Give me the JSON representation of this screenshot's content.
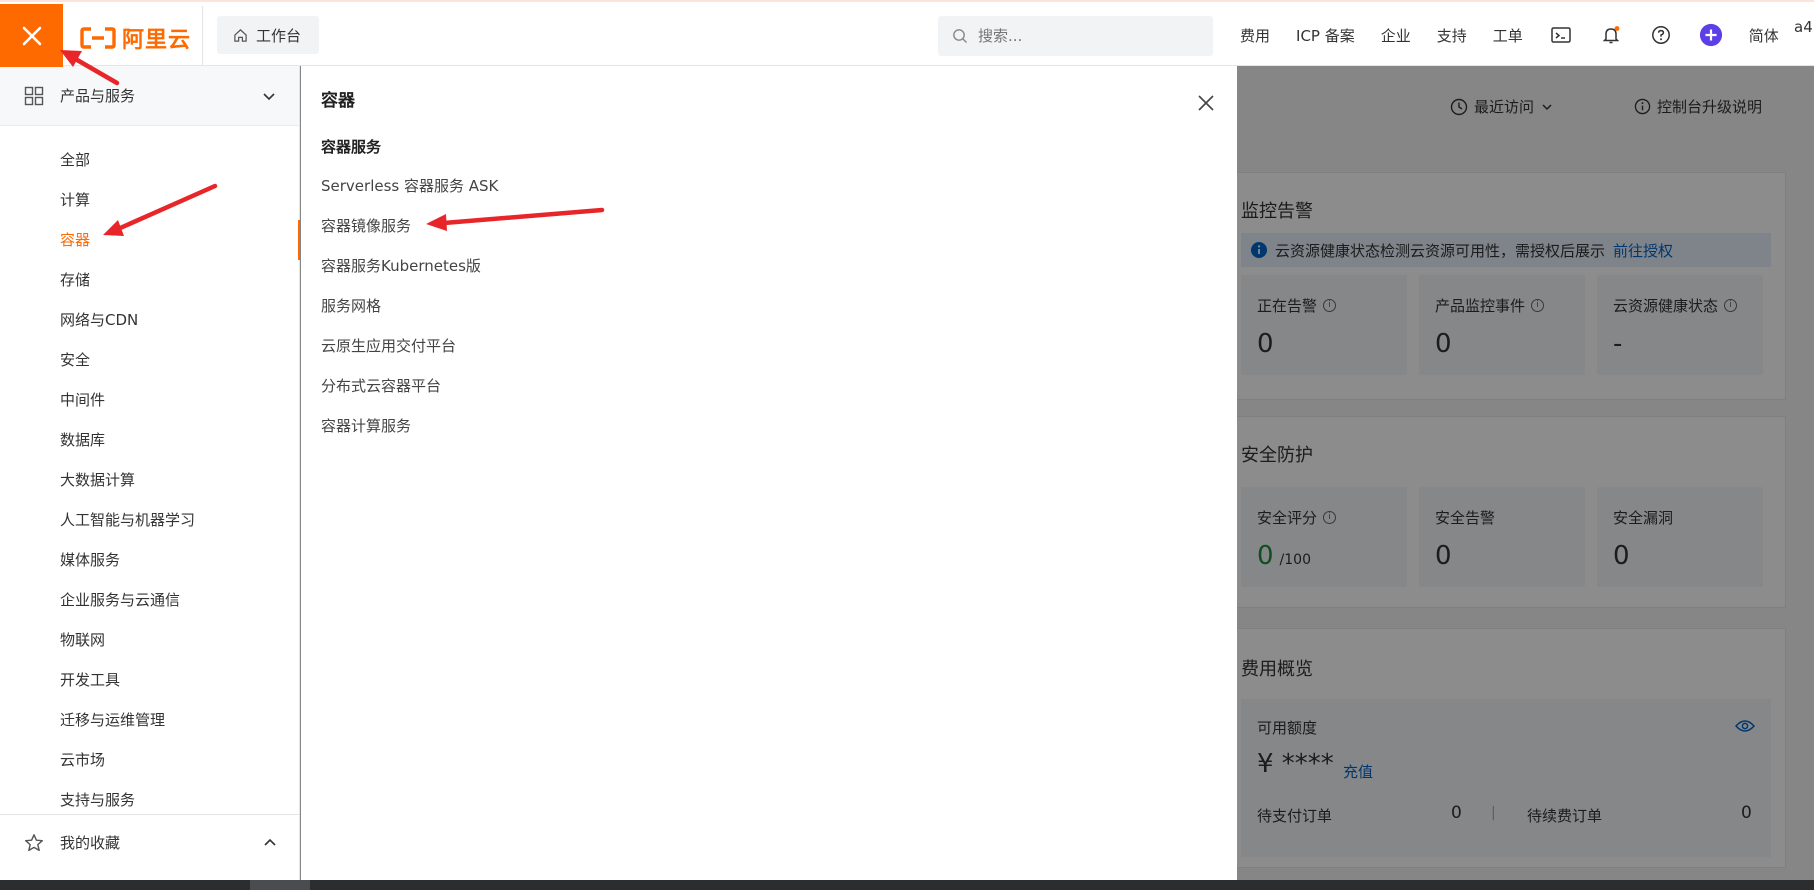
{
  "topbar": {
    "logo_text": "阿里云",
    "workbench_label": "工作台",
    "search_placeholder": "搜索...",
    "links": [
      "费用",
      "ICP 备案",
      "企业",
      "支持",
      "工单"
    ],
    "lang_label": "简体",
    "user_truncated": "a4"
  },
  "category_panel": {
    "header_label": "产品与服务",
    "items": [
      "全部",
      "计算",
      "容器",
      "存储",
      "网络与CDN",
      "安全",
      "中间件",
      "数据库",
      "大数据计算",
      "人工智能与机器学习",
      "媒体服务",
      "企业服务与云通信",
      "物联网",
      "开发工具",
      "迁移与运维管理",
      "云市场",
      "支持与服务"
    ],
    "active_item": "容器",
    "favorites_label": "我的收藏"
  },
  "sub_panel": {
    "title": "容器",
    "section_title": "容器服务",
    "items": [
      "Serverless 容器服务 ASK",
      "容器镜像服务",
      "容器服务Kubernetes版",
      "服务网格",
      "云原生应用交付平台",
      "分布式云容器平台",
      "容器计算服务"
    ]
  },
  "dashboard": {
    "recent_label": "最近访问",
    "upgrade_label": "控制台升级说明",
    "monitor": {
      "title": "监控告警",
      "notice_text": "云资源健康状态检测云资源可用性，需授权后展示",
      "notice_link": "前往授权",
      "tiles": [
        {
          "label": "正在告警",
          "value": "0"
        },
        {
          "label": "产品监控事件",
          "value": "0"
        },
        {
          "label": "云资源健康状态",
          "value": "-"
        }
      ]
    },
    "security": {
      "title": "安全防护",
      "score_label": "安全评分",
      "score_value": "0",
      "score_max": "/100",
      "alert_label": "安全告警",
      "alert_value": "0",
      "vuln_label": "安全漏洞",
      "vuln_value": "0"
    },
    "billing": {
      "title": "费用概览",
      "quota_label": "可用额度",
      "quota_value": "¥ ****",
      "recharge_label": "充值",
      "pending_pay_label": "待支付订单",
      "pending_pay_value": "0",
      "renew_label": "待续费订单",
      "renew_value": "0",
      "separator": "|"
    }
  },
  "colors": {
    "brand": "#ff6a00",
    "link": "#0064c8",
    "score_green": "#1e8e3e",
    "annotation_red": "#e8262a"
  }
}
